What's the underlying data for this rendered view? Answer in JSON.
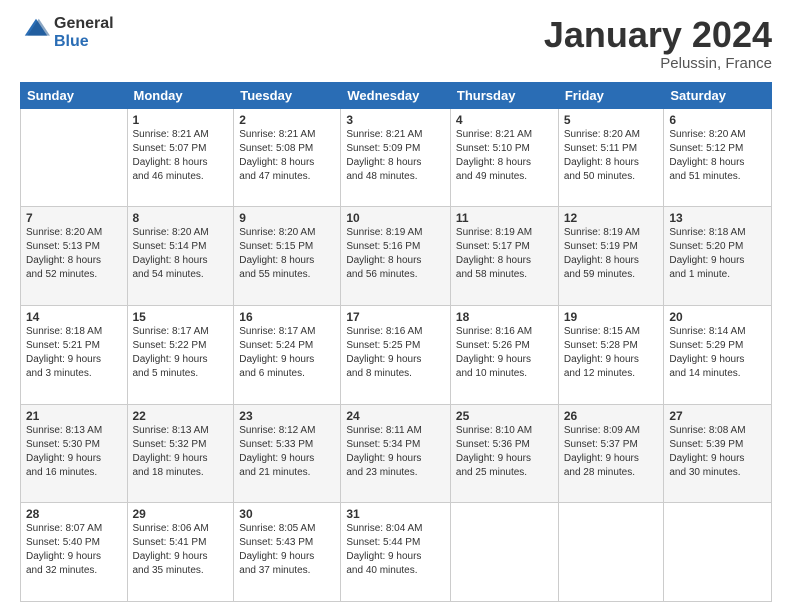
{
  "header": {
    "logo_line1": "General",
    "logo_line2": "Blue",
    "title": "January 2024",
    "subtitle": "Pelussin, France"
  },
  "weekdays": [
    "Sunday",
    "Monday",
    "Tuesday",
    "Wednesday",
    "Thursday",
    "Friday",
    "Saturday"
  ],
  "weeks": [
    [
      {
        "day": "",
        "info": ""
      },
      {
        "day": "1",
        "info": "Sunrise: 8:21 AM\nSunset: 5:07 PM\nDaylight: 8 hours\nand 46 minutes."
      },
      {
        "day": "2",
        "info": "Sunrise: 8:21 AM\nSunset: 5:08 PM\nDaylight: 8 hours\nand 47 minutes."
      },
      {
        "day": "3",
        "info": "Sunrise: 8:21 AM\nSunset: 5:09 PM\nDaylight: 8 hours\nand 48 minutes."
      },
      {
        "day": "4",
        "info": "Sunrise: 8:21 AM\nSunset: 5:10 PM\nDaylight: 8 hours\nand 49 minutes."
      },
      {
        "day": "5",
        "info": "Sunrise: 8:20 AM\nSunset: 5:11 PM\nDaylight: 8 hours\nand 50 minutes."
      },
      {
        "day": "6",
        "info": "Sunrise: 8:20 AM\nSunset: 5:12 PM\nDaylight: 8 hours\nand 51 minutes."
      }
    ],
    [
      {
        "day": "7",
        "info": "Sunrise: 8:20 AM\nSunset: 5:13 PM\nDaylight: 8 hours\nand 52 minutes."
      },
      {
        "day": "8",
        "info": "Sunrise: 8:20 AM\nSunset: 5:14 PM\nDaylight: 8 hours\nand 54 minutes."
      },
      {
        "day": "9",
        "info": "Sunrise: 8:20 AM\nSunset: 5:15 PM\nDaylight: 8 hours\nand 55 minutes."
      },
      {
        "day": "10",
        "info": "Sunrise: 8:19 AM\nSunset: 5:16 PM\nDaylight: 8 hours\nand 56 minutes."
      },
      {
        "day": "11",
        "info": "Sunrise: 8:19 AM\nSunset: 5:17 PM\nDaylight: 8 hours\nand 58 minutes."
      },
      {
        "day": "12",
        "info": "Sunrise: 8:19 AM\nSunset: 5:19 PM\nDaylight: 8 hours\nand 59 minutes."
      },
      {
        "day": "13",
        "info": "Sunrise: 8:18 AM\nSunset: 5:20 PM\nDaylight: 9 hours\nand 1 minute."
      }
    ],
    [
      {
        "day": "14",
        "info": "Sunrise: 8:18 AM\nSunset: 5:21 PM\nDaylight: 9 hours\nand 3 minutes."
      },
      {
        "day": "15",
        "info": "Sunrise: 8:17 AM\nSunset: 5:22 PM\nDaylight: 9 hours\nand 5 minutes."
      },
      {
        "day": "16",
        "info": "Sunrise: 8:17 AM\nSunset: 5:24 PM\nDaylight: 9 hours\nand 6 minutes."
      },
      {
        "day": "17",
        "info": "Sunrise: 8:16 AM\nSunset: 5:25 PM\nDaylight: 9 hours\nand 8 minutes."
      },
      {
        "day": "18",
        "info": "Sunrise: 8:16 AM\nSunset: 5:26 PM\nDaylight: 9 hours\nand 10 minutes."
      },
      {
        "day": "19",
        "info": "Sunrise: 8:15 AM\nSunset: 5:28 PM\nDaylight: 9 hours\nand 12 minutes."
      },
      {
        "day": "20",
        "info": "Sunrise: 8:14 AM\nSunset: 5:29 PM\nDaylight: 9 hours\nand 14 minutes."
      }
    ],
    [
      {
        "day": "21",
        "info": "Sunrise: 8:13 AM\nSunset: 5:30 PM\nDaylight: 9 hours\nand 16 minutes."
      },
      {
        "day": "22",
        "info": "Sunrise: 8:13 AM\nSunset: 5:32 PM\nDaylight: 9 hours\nand 18 minutes."
      },
      {
        "day": "23",
        "info": "Sunrise: 8:12 AM\nSunset: 5:33 PM\nDaylight: 9 hours\nand 21 minutes."
      },
      {
        "day": "24",
        "info": "Sunrise: 8:11 AM\nSunset: 5:34 PM\nDaylight: 9 hours\nand 23 minutes."
      },
      {
        "day": "25",
        "info": "Sunrise: 8:10 AM\nSunset: 5:36 PM\nDaylight: 9 hours\nand 25 minutes."
      },
      {
        "day": "26",
        "info": "Sunrise: 8:09 AM\nSunset: 5:37 PM\nDaylight: 9 hours\nand 28 minutes."
      },
      {
        "day": "27",
        "info": "Sunrise: 8:08 AM\nSunset: 5:39 PM\nDaylight: 9 hours\nand 30 minutes."
      }
    ],
    [
      {
        "day": "28",
        "info": "Sunrise: 8:07 AM\nSunset: 5:40 PM\nDaylight: 9 hours\nand 32 minutes."
      },
      {
        "day": "29",
        "info": "Sunrise: 8:06 AM\nSunset: 5:41 PM\nDaylight: 9 hours\nand 35 minutes."
      },
      {
        "day": "30",
        "info": "Sunrise: 8:05 AM\nSunset: 5:43 PM\nDaylight: 9 hours\nand 37 minutes."
      },
      {
        "day": "31",
        "info": "Sunrise: 8:04 AM\nSunset: 5:44 PM\nDaylight: 9 hours\nand 40 minutes."
      },
      {
        "day": "",
        "info": ""
      },
      {
        "day": "",
        "info": ""
      },
      {
        "day": "",
        "info": ""
      }
    ]
  ]
}
